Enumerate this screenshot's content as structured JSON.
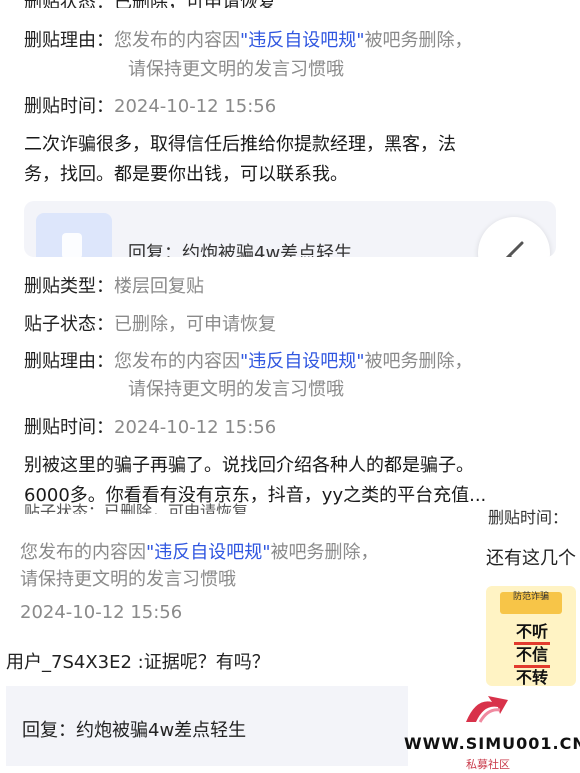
{
  "section1": {
    "cut_top_text": "删贴状态：已删除，可申请恢复",
    "reason_label": "删贴理由：",
    "reason_pre": "您发布的内容因",
    "reason_keyword": "\"违反自设吧规\"",
    "reason_post": "被吧务删除，",
    "reason_line2": "请保持更文明的发言习惯哦",
    "time_label": "删贴时间：",
    "time_value": "2024-10-12 15:56",
    "content_line1": "二次诈骗很多，取得信任后推给你提款经理，黑客，法",
    "content_line2": "务，找回。都是要你出钱，可以联系我。",
    "reply_card_title": "回复：约炮被骗4w差点轻生"
  },
  "section2": {
    "type_label": "删贴类型：",
    "type_value": "楼层回复贴",
    "status_label": "贴子状态：",
    "status_value": "已删除，可申请恢复",
    "reason_label": "删贴理由：",
    "reason_pre": "您发布的内容因",
    "reason_keyword": "\"违反自设吧规\"",
    "reason_post": "被吧务删除，",
    "reason_line2": "请保持更文明的发言习惯哦",
    "time_label": "删贴时间：",
    "time_value": "2024-10-12 15:56",
    "content_line1": "别被这里的骗子再骗了。说找回介绍各种人的都是骗子。",
    "content_line2": "6000多。你看看有没有京东，抖音，yy之类的平台充值..."
  },
  "section3": {
    "cut_top_text": "贴子状态：已删除，可申请恢复",
    "reason_pre": "您发布的内容因",
    "reason_keyword": "\"违反自设吧规\"",
    "reason_post": "被吧务删除，",
    "reason_line2": "请保持更文明的发言习惯哦",
    "time_value": "2024-10-12 15:56",
    "user_comment": "用户_7S4X3E2 :证据呢？有吗？",
    "reply_text": "回复：约炮被骗4w差点轻生"
  },
  "right_column": {
    "cut_top_text": "删贴时间：",
    "text": "还有这几个",
    "thumb_top": "防范诈骗",
    "thumb_words": [
      "不听",
      "不信",
      "不转账"
    ]
  },
  "watermark": {
    "site": "WWW.SIMU001.CN",
    "sub": "私募社区"
  },
  "colors": {
    "keyword": "#2f56e0",
    "gray_text": "#8a8a8a",
    "card_bg": "#f3f4f9",
    "watermark_red": "#c93a4a"
  },
  "icons": {
    "fab": "broom-icon",
    "card": "document-icon",
    "watermark": "arrow-logo-icon"
  }
}
